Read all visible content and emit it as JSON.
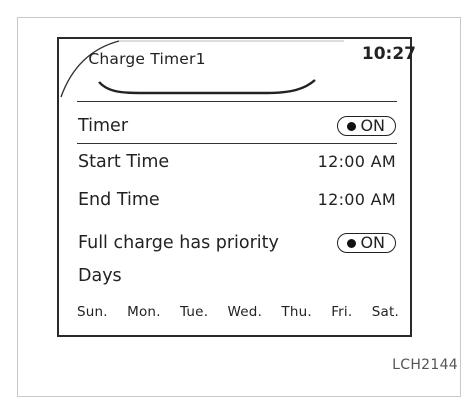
{
  "screen": {
    "title": "Charge Timer1",
    "clock": "10:27"
  },
  "rows": {
    "timer": {
      "label": "Timer",
      "toggle": "ON"
    },
    "start_time": {
      "label": "Start Time",
      "value": "12:00 AM"
    },
    "end_time": {
      "label": "End Time",
      "value": "12:00 AM"
    },
    "full_charge": {
      "label": "Full charge has priority",
      "toggle": "ON"
    },
    "days": {
      "label": "Days"
    }
  },
  "days": [
    "Sun.",
    "Mon.",
    "Tue.",
    "Wed.",
    "Thu.",
    "Fri.",
    "Sat."
  ],
  "figure_code": "LCH2144"
}
